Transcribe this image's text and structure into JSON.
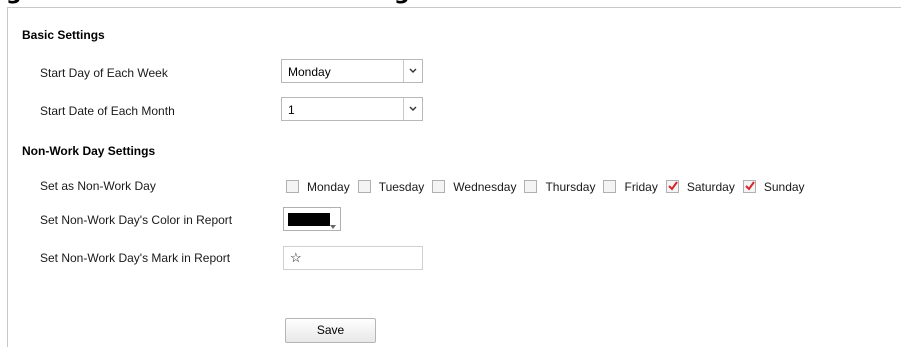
{
  "heading": {
    "left": "g",
    "right": "g"
  },
  "basic": {
    "title": "Basic Settings",
    "start_day_label": "Start Day of Each Week",
    "start_day_value": "Monday",
    "start_date_label": "Start Date of Each Month",
    "start_date_value": "1"
  },
  "nonwork": {
    "title": "Non-Work Day Settings",
    "set_label": "Set as Non-Work Day",
    "days": [
      {
        "label": "Monday",
        "checked": false
      },
      {
        "label": "Tuesday",
        "checked": false
      },
      {
        "label": "Wednesday",
        "checked": false
      },
      {
        "label": "Thursday",
        "checked": false
      },
      {
        "label": "Friday",
        "checked": false
      },
      {
        "label": "Saturday",
        "checked": true
      },
      {
        "label": "Sunday",
        "checked": true
      }
    ],
    "color_label": "Set Non-Work Day's Color in Report",
    "color_value": "#000000",
    "mark_label": "Set Non-Work Day's Mark in Report",
    "mark_value": "☆"
  },
  "actions": {
    "save_label": "Save"
  },
  "icons": {
    "dropdown": "chevron-down-icon",
    "check": "checkmark-icon"
  },
  "colors": {
    "check": "#d8262b",
    "border": "#b8b8b8"
  }
}
